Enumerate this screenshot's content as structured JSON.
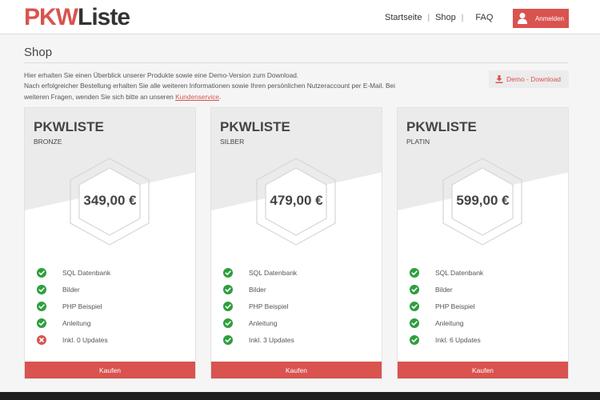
{
  "header": {
    "logo_primary": "PKW",
    "logo_secondary": "Liste",
    "nav": [
      "Startseite",
      "Shop",
      "FAQ"
    ],
    "separator": "|",
    "login_label": "Anmelden",
    "login_icon": "user-icon"
  },
  "page": {
    "title": "Shop",
    "intro_line1": "Hier erhalten Sie einen Überblick unserer Produkte sowie eine Demo-Version zum Download.",
    "intro_line2": "Nach erfolgreicher Bestellung erhalten Sie alle weiteren Informationen sowie Ihren persönlichen Nutzeraccount per E-Mail. Bei weiteren Fragen, wenden Sie sich bitte an unseren",
    "intro_link": "Kundenservice",
    "intro_end": ".",
    "demo_label": "Demo - Download",
    "demo_icon": "download-icon"
  },
  "colors": {
    "accent": "#d9534f",
    "check": "#2e9e3e",
    "cross": "#d9534f"
  },
  "products": [
    {
      "name": "PKWLISTE",
      "tier": "BRONZE",
      "price": "349,00 €",
      "buy_label": "Kaufen",
      "features": [
        {
          "label": "SQL Datenbank",
          "included": true
        },
        {
          "label": "Bilder",
          "included": true
        },
        {
          "label": "PHP Beispiel",
          "included": true
        },
        {
          "label": "Anleitung",
          "included": true
        },
        {
          "label": "Inkl. 0 Updates",
          "included": false
        }
      ]
    },
    {
      "name": "PKWLISTE",
      "tier": "SILBER",
      "price": "479,00 €",
      "buy_label": "Kaufen",
      "features": [
        {
          "label": "SQL Datenbank",
          "included": true
        },
        {
          "label": "Bilder",
          "included": true
        },
        {
          "label": "PHP Beispiel",
          "included": true
        },
        {
          "label": "Anleitung",
          "included": true
        },
        {
          "label": "Inkl. 3 Updates",
          "included": true
        }
      ]
    },
    {
      "name": "PKWLISTE",
      "tier": "PLATIN",
      "price": "599,00 €",
      "buy_label": "Kaufen",
      "features": [
        {
          "label": "SQL Datenbank",
          "included": true
        },
        {
          "label": "Bilder",
          "included": true
        },
        {
          "label": "PHP Beispiel",
          "included": true
        },
        {
          "label": "Anleitung",
          "included": true
        },
        {
          "label": "Inkl. 6 Updates",
          "included": true
        }
      ]
    }
  ]
}
